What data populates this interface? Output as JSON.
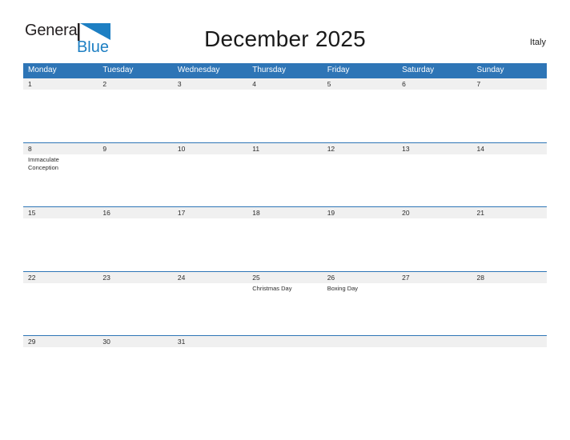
{
  "brand": {
    "name_part1": "General",
    "name_part2": "Blue",
    "flag_icon": "flag-triangle-icon",
    "blue": "#1d7fc3"
  },
  "header": {
    "title": "December 2025",
    "country": "Italy"
  },
  "colors": {
    "header_blue": "#2e75b6",
    "band_gray": "#f0f0f0",
    "text_dark": "#2b2b2b"
  },
  "calendar": {
    "weekdays": [
      "Monday",
      "Tuesday",
      "Wednesday",
      "Thursday",
      "Friday",
      "Saturday",
      "Sunday"
    ],
    "weeks": [
      {
        "days": [
          {
            "num": "1",
            "event": ""
          },
          {
            "num": "2",
            "event": ""
          },
          {
            "num": "3",
            "event": ""
          },
          {
            "num": "4",
            "event": ""
          },
          {
            "num": "5",
            "event": ""
          },
          {
            "num": "6",
            "event": ""
          },
          {
            "num": "7",
            "event": ""
          }
        ]
      },
      {
        "days": [
          {
            "num": "8",
            "event": "Immaculate Conception"
          },
          {
            "num": "9",
            "event": ""
          },
          {
            "num": "10",
            "event": ""
          },
          {
            "num": "11",
            "event": ""
          },
          {
            "num": "12",
            "event": ""
          },
          {
            "num": "13",
            "event": ""
          },
          {
            "num": "14",
            "event": ""
          }
        ]
      },
      {
        "days": [
          {
            "num": "15",
            "event": ""
          },
          {
            "num": "16",
            "event": ""
          },
          {
            "num": "17",
            "event": ""
          },
          {
            "num": "18",
            "event": ""
          },
          {
            "num": "19",
            "event": ""
          },
          {
            "num": "20",
            "event": ""
          },
          {
            "num": "21",
            "event": ""
          }
        ]
      },
      {
        "days": [
          {
            "num": "22",
            "event": ""
          },
          {
            "num": "23",
            "event": ""
          },
          {
            "num": "24",
            "event": ""
          },
          {
            "num": "25",
            "event": "Christmas Day"
          },
          {
            "num": "26",
            "event": "Boxing Day"
          },
          {
            "num": "27",
            "event": ""
          },
          {
            "num": "28",
            "event": ""
          }
        ]
      },
      {
        "days": [
          {
            "num": "29",
            "event": ""
          },
          {
            "num": "30",
            "event": ""
          },
          {
            "num": "31",
            "event": ""
          },
          {
            "num": "",
            "event": ""
          },
          {
            "num": "",
            "event": ""
          },
          {
            "num": "",
            "event": ""
          },
          {
            "num": "",
            "event": ""
          }
        ]
      }
    ]
  }
}
